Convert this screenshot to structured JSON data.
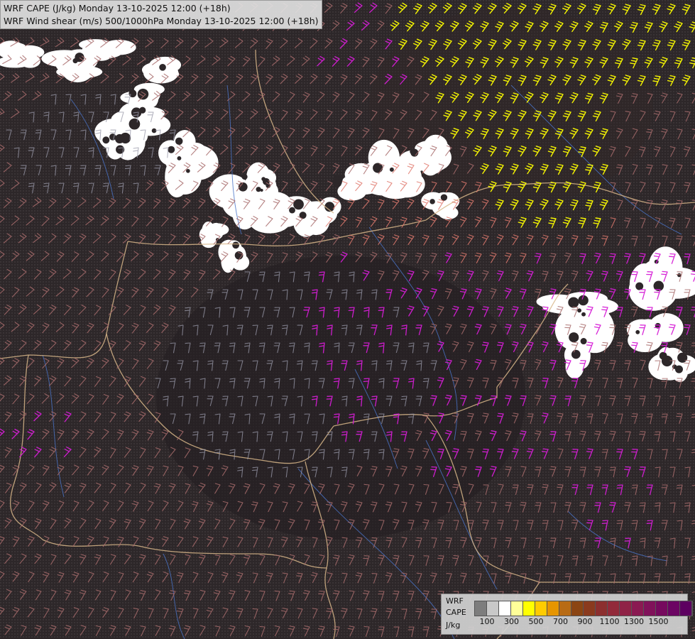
{
  "title": {
    "line1": "WRF CAPE (J/kg) Monday 13-10-2025 12:00 (+18h)",
    "line2": "WRF Wind shear (m/s) 500/1000hPa Monday 13-10-2025 12:00 (+18h)"
  },
  "legend": {
    "title_lines": [
      "WRF",
      "CAPE",
      "J/kg"
    ],
    "colors": [
      "#7d7d7d",
      "#c8c8c8",
      "#ffffff",
      "#ffff99",
      "#ffff00",
      "#ffcc00",
      "#e69500",
      "#b86b14",
      "#8b4513",
      "#8a3a1e",
      "#8c2f2f",
      "#922a3a",
      "#8f2246",
      "#8a1a52",
      "#80125a",
      "#760a5e",
      "#6c0563",
      "#5d0060"
    ],
    "tick_labels": [
      "100",
      "300",
      "500",
      "700",
      "900",
      "1100",
      "1300",
      "1500"
    ]
  },
  "colors": {
    "background": "#2b2527",
    "barb_brown": "#a86c6c",
    "barb_gray": "#9a9aaa",
    "barb_magenta": "#d61ed6",
    "barb_yellow": "#ffff00",
    "barb_salmon": "#e07a6e",
    "cloud_white": "#ffffff",
    "border": "#d9b78a",
    "river": "#4a74c8"
  }
}
